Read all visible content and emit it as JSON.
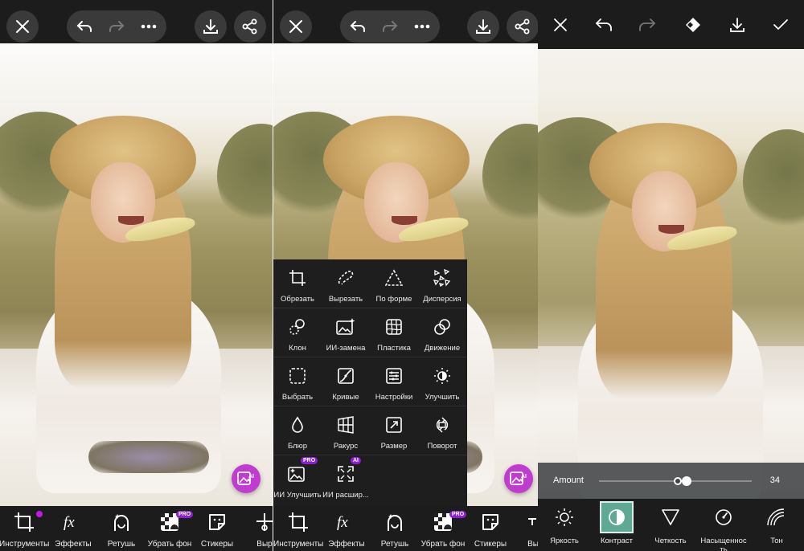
{
  "colors": {
    "toolbar_bg": "#1c1c1c",
    "button_bg": "#3a3a3a",
    "accent_purple": "#c318e8",
    "fab_pink": "#c03bd0",
    "selected_teal": "#5fa894"
  },
  "panel1": {
    "bottom_tools": [
      {
        "label": "Инструменты",
        "icon": "crop-icon",
        "has_dot": true
      },
      {
        "label": "Эффекты",
        "icon": "fx-icon"
      },
      {
        "label": "Ретушь",
        "icon": "retouch-face-icon"
      },
      {
        "label": "Убрать фон",
        "icon": "remove-background-icon",
        "badge": "PRO"
      },
      {
        "label": "Стикеры",
        "icon": "sticker-icon"
      },
      {
        "label": "Выр",
        "icon": "cutout-icon"
      }
    ],
    "fab_badge": "AI"
  },
  "panel2": {
    "menu": [
      [
        {
          "label": "Обрезать",
          "icon": "crop-icon"
        },
        {
          "label": "Вырезать",
          "icon": "free-crop-icon"
        },
        {
          "label": "По форме",
          "icon": "shape-crop-icon"
        },
        {
          "label": "Дисперсия",
          "icon": "dispersion-icon"
        }
      ],
      [
        {
          "label": "Клон",
          "icon": "clone-icon"
        },
        {
          "label": "ИИ-замена",
          "icon": "ai-replace-icon"
        },
        {
          "label": "Пластика",
          "icon": "stretch-icon"
        },
        {
          "label": "Движение",
          "icon": "motion-icon"
        }
      ],
      [
        {
          "label": "Выбрать",
          "icon": "select-icon"
        },
        {
          "label": "Кривые",
          "icon": "curves-icon"
        },
        {
          "label": "Настройки",
          "icon": "adjust-icon"
        },
        {
          "label": "Улучшить",
          "icon": "enhance-icon"
        }
      ],
      [
        {
          "label": "Блюр",
          "icon": "blur-drop-icon"
        },
        {
          "label": "Ракурс",
          "icon": "perspective-icon"
        },
        {
          "label": "Размер",
          "icon": "resize-icon"
        },
        {
          "label": "Поворот",
          "icon": "rotate-icon"
        }
      ],
      [
        {
          "label": "ИИ Улучшить",
          "icon": "ai-enhance-icon",
          "badge": "PRO"
        },
        {
          "label": "ИИ расшир...",
          "icon": "ai-expand-icon",
          "badge": "AI"
        }
      ]
    ],
    "bottom_tools": [
      {
        "label": "Инструменты",
        "icon": "crop-icon"
      },
      {
        "label": "Эффекты",
        "icon": "fx-icon"
      },
      {
        "label": "Ретушь",
        "icon": "retouch-face-icon"
      },
      {
        "label": "Убрать фон",
        "icon": "remove-background-icon",
        "badge": "PRO"
      },
      {
        "label": "Стикеры",
        "icon": "sticker-icon"
      },
      {
        "label": "Вы",
        "icon": "text-icon"
      }
    ],
    "fab_badge": "AI"
  },
  "panel3": {
    "amount": {
      "label": "Amount",
      "value": "34",
      "fraction": 0.34
    },
    "adjustments": [
      {
        "label": "Яркость",
        "icon": "brightness-icon"
      },
      {
        "label": "Контраст",
        "icon": "contrast-icon",
        "selected": true
      },
      {
        "label": "Четкость",
        "icon": "clarity-icon"
      },
      {
        "label": "Насыщеннос\nть",
        "icon": "saturation-icon"
      },
      {
        "label": "Тон",
        "icon": "tone-icon"
      }
    ]
  }
}
